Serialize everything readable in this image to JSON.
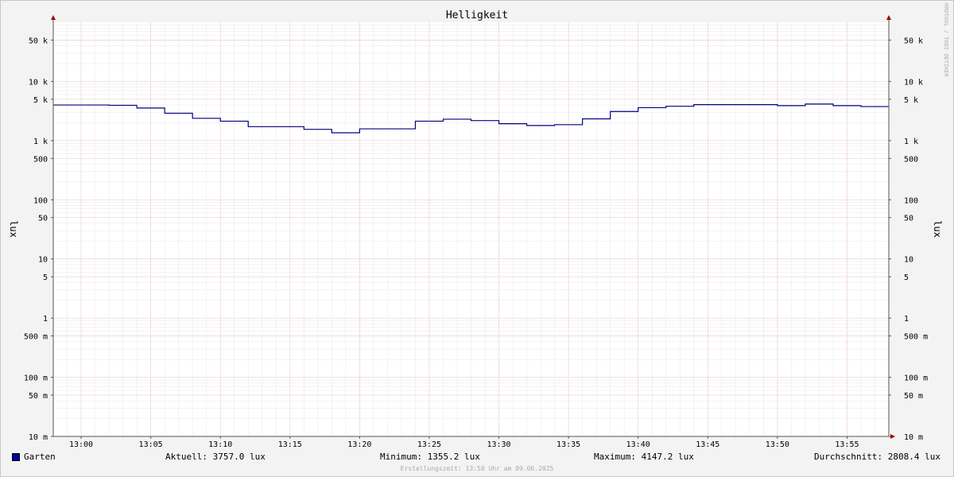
{
  "watermark": "RRDTOOL / TOBI OETIKER",
  "footer": "Erstellungszeit: 13:58 Uhr am 09.06.2025",
  "legend": {
    "series": "Garten",
    "current": "Aktuell: 3757.0 lux",
    "minimum": "Minimum: 1355.2 lux",
    "maximum": "Maximum: 4147.2 lux",
    "average": "Durchschnitt: 2808.4 lux"
  },
  "chart_data": {
    "type": "line",
    "title": "Helligkeit",
    "ylabel": "lux",
    "ylabel_right": "lux",
    "y_scale": "log",
    "ylim": [
      0.01,
      100000
    ],
    "y_ticks": [
      {
        "value": 0.01,
        "label": "10 m"
      },
      {
        "value": 0.05,
        "label": "50 m"
      },
      {
        "value": 0.1,
        "label": "100 m"
      },
      {
        "value": 0.5,
        "label": "500 m"
      },
      {
        "value": 1,
        "label": "1"
      },
      {
        "value": 5,
        "label": "5"
      },
      {
        "value": 10,
        "label": "10"
      },
      {
        "value": 50,
        "label": "50"
      },
      {
        "value": 100,
        "label": "100"
      },
      {
        "value": 500,
        "label": "500"
      },
      {
        "value": 1000,
        "label": "1 k"
      },
      {
        "value": 5000,
        "label": "5 k"
      },
      {
        "value": 10000,
        "label": "10 k"
      },
      {
        "value": 50000,
        "label": "50 k"
      }
    ],
    "xlim": [
      "12:58",
      "13:58"
    ],
    "x_ticks": [
      "13:00",
      "13:05",
      "13:10",
      "13:15",
      "13:20",
      "13:25",
      "13:30",
      "13:35",
      "13:40",
      "13:45",
      "13:50",
      "13:55"
    ],
    "grid": true,
    "legend_position": "bottom",
    "colors": {
      "series": "#000080",
      "grid_minor": "#d0d0d0",
      "grid_major": "#e09aa8",
      "axis": "#555555",
      "arrow": "#a00000"
    },
    "series": [
      {
        "name": "Garten",
        "values": [
          {
            "x": "12:58",
            "y": 4000
          },
          {
            "x": "13:02",
            "y": 3950
          },
          {
            "x": "13:04",
            "y": 3550
          },
          {
            "x": "13:06",
            "y": 2900
          },
          {
            "x": "13:08",
            "y": 2380
          },
          {
            "x": "13:10",
            "y": 2130
          },
          {
            "x": "13:12",
            "y": 1720
          },
          {
            "x": "13:16",
            "y": 1550
          },
          {
            "x": "13:18",
            "y": 1355.2
          },
          {
            "x": "13:20",
            "y": 1580
          },
          {
            "x": "13:24",
            "y": 2130
          },
          {
            "x": "13:26",
            "y": 2300
          },
          {
            "x": "13:28",
            "y": 2180
          },
          {
            "x": "13:30",
            "y": 1930
          },
          {
            "x": "13:32",
            "y": 1800
          },
          {
            "x": "13:34",
            "y": 1860
          },
          {
            "x": "13:36",
            "y": 2330
          },
          {
            "x": "13:38",
            "y": 3100
          },
          {
            "x": "13:40",
            "y": 3600
          },
          {
            "x": "13:42",
            "y": 3800
          },
          {
            "x": "13:44",
            "y": 4050
          },
          {
            "x": "13:50",
            "y": 3900
          },
          {
            "x": "13:52",
            "y": 4147.2
          },
          {
            "x": "13:54",
            "y": 3900
          },
          {
            "x": "13:56",
            "y": 3757
          }
        ]
      }
    ]
  }
}
